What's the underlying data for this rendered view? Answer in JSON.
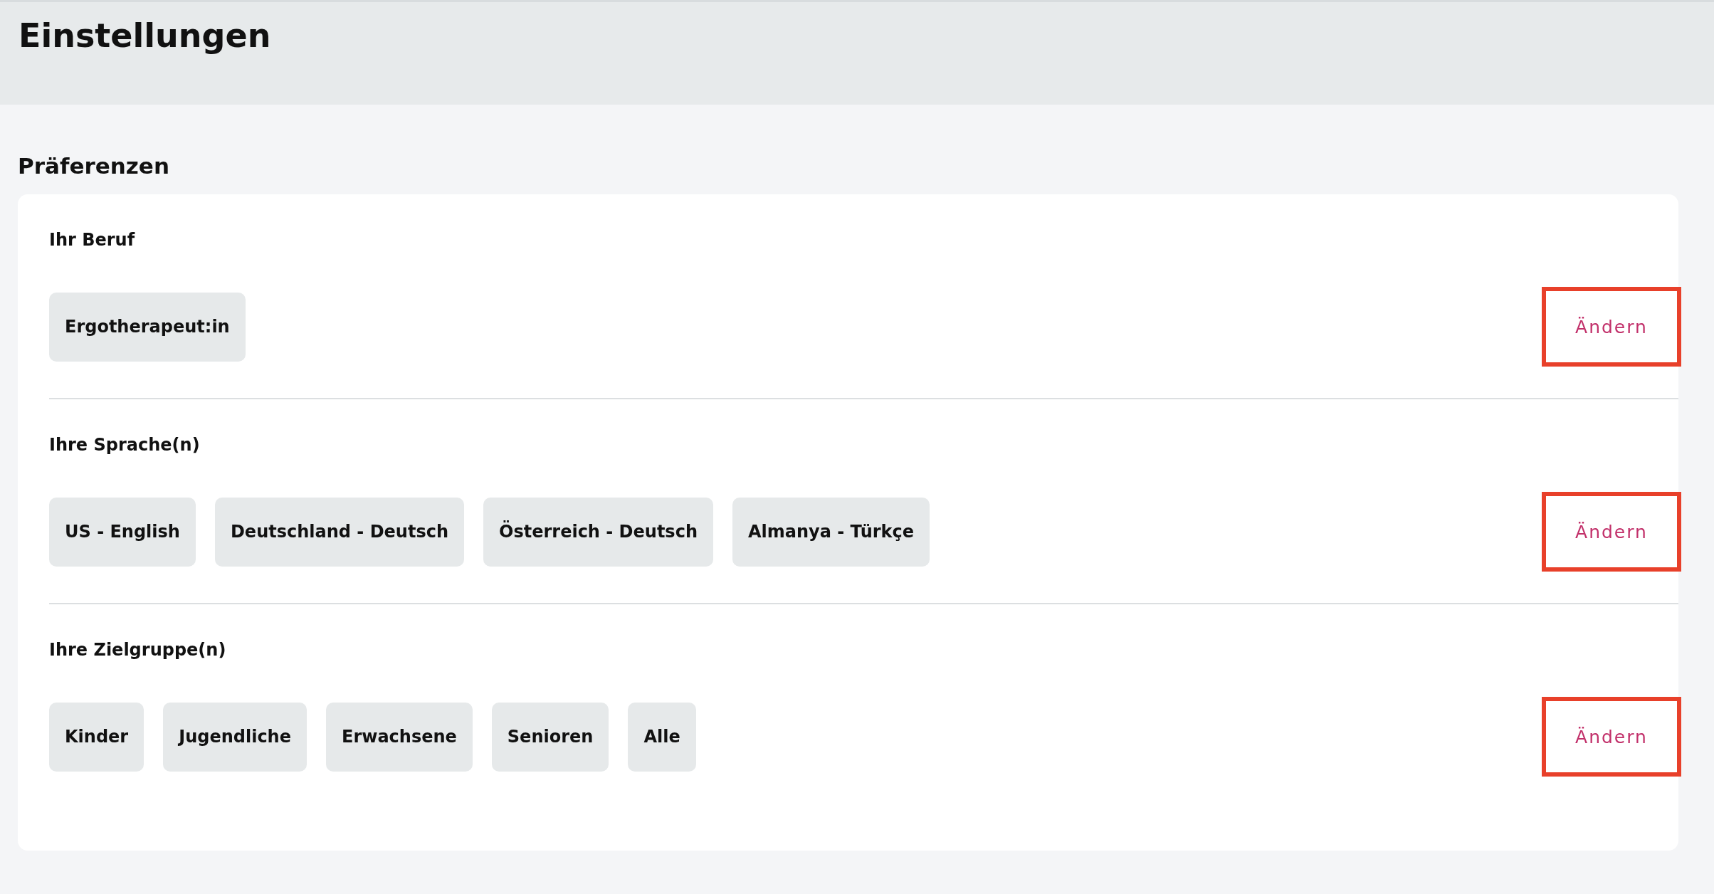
{
  "header": {
    "title": "Einstellungen"
  },
  "section": {
    "title": "Präferenzen"
  },
  "groups": [
    {
      "label": "Ihr Beruf",
      "chips": [
        "Ergotherapeut:in"
      ],
      "button": {
        "label": "Ändern",
        "highlighted": true
      }
    },
    {
      "label": "Ihre Sprache(n)",
      "chips": [
        "US - English",
        "Deutschland - Deutsch",
        "Österreich - Deutsch",
        "Almanya - Türkçe"
      ],
      "button": {
        "label": "Ändern",
        "highlighted": true
      }
    },
    {
      "label": "Ihre Zielgruppe(n)",
      "chips": [
        "Kinder",
        "Jugendliche",
        "Erwachsene",
        "Senioren",
        "Alle"
      ],
      "button": {
        "label": "Ändern",
        "highlighted": true
      }
    }
  ]
}
